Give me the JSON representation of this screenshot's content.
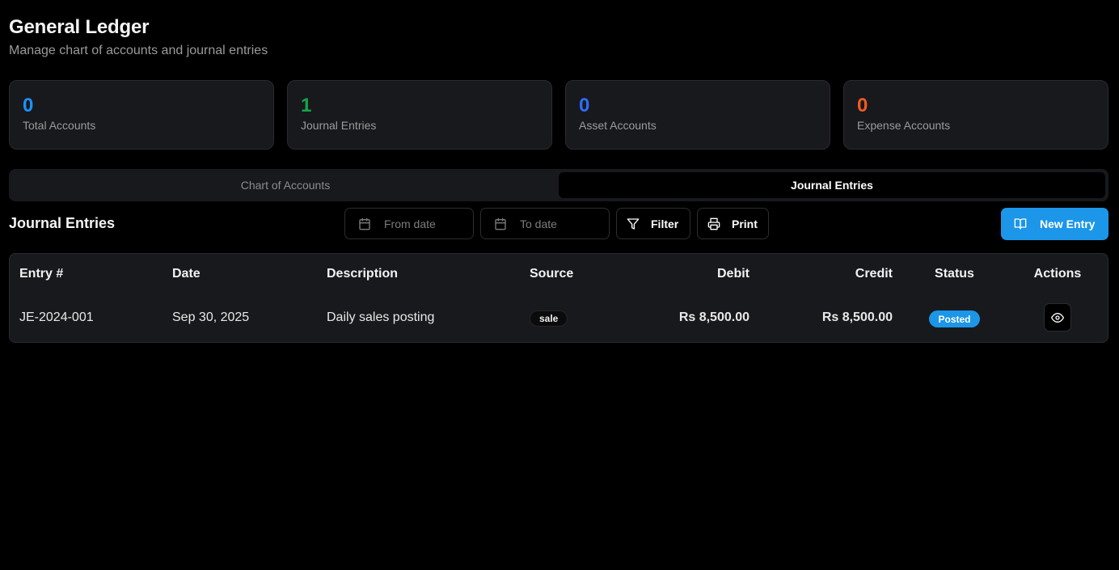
{
  "header": {
    "title": "General Ledger",
    "subtitle": "Manage chart of accounts and journal entries"
  },
  "stats": [
    {
      "value": "0",
      "label": "Total Accounts",
      "color": "#1e90ff"
    },
    {
      "value": "1",
      "label": "Journal Entries",
      "color": "#16a34a"
    },
    {
      "value": "0",
      "label": "Asset Accounts",
      "color": "#2f6bff"
    },
    {
      "value": "0",
      "label": "Expense Accounts",
      "color": "#f15a22"
    }
  ],
  "tabs": [
    {
      "label": "Chart of Accounts",
      "active": false
    },
    {
      "label": "Journal Entries",
      "active": true
    }
  ],
  "journal": {
    "title": "Journal Entries",
    "from_placeholder": "From date",
    "to_placeholder": "To date",
    "filter_label": "Filter",
    "print_label": "Print",
    "new_entry_label": "New Entry",
    "columns": [
      "Entry #",
      "Date",
      "Description",
      "Source",
      "Debit",
      "Credit",
      "Status",
      "Actions"
    ],
    "rows": [
      {
        "entry": "JE-2024-001",
        "date": "Sep 30, 2025",
        "description": "Daily sales posting",
        "source": "sale",
        "debit": "Rs 8,500.00",
        "credit": "Rs 8,500.00",
        "status": "Posted"
      }
    ]
  },
  "icons": {
    "calendar": "calendar-icon",
    "filter": "filter-icon",
    "print": "printer-icon",
    "new_entry": "book-open-icon",
    "view": "eye-icon"
  },
  "accent_color": "#1c96e8"
}
